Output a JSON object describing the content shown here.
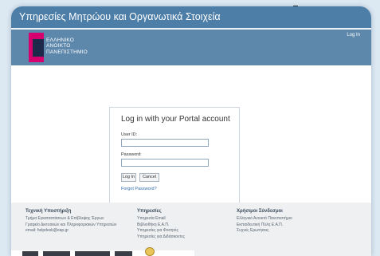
{
  "window": {
    "title": "Υπηρεσίες Μητρώου και Οργανωτικά Στοιχεία"
  },
  "header": {
    "logo_lines": [
      "ΕΛΛΗΝΙΚΟ",
      "ΑΝΟΙΚΤΟ",
      "ΠΑΝΕΠΙΣΤΗΜΙΟ"
    ],
    "login_link": "Log In",
    "colors": {
      "title_bar": "#4d7ea8",
      "banner": "#5e88ab",
      "logo_magenta": "#d6006e",
      "logo_navy": "#1e2a4a"
    }
  },
  "login": {
    "title": "Log in with your Portal account",
    "user_id_label": "User ID:",
    "user_id_value": "",
    "password_label": "Password:",
    "password_value": "",
    "login_button": "Log In",
    "cancel_button": "Cancel",
    "forgot_link": "Forgot Password?"
  },
  "footer": {
    "columns": [
      {
        "heading": "Τεχνική Υποστήριξη",
        "links": [
          "Τμήμα Εγκαταστάσεων & Επίβλεψης Έργων",
          "Γραφείο Δικτυακών και Πληροφοριακών Υπηρεσιών",
          "email: helpdesk@eap.gr"
        ]
      },
      {
        "heading": "Υπηρεσίες",
        "links": [
          "Υπηρεσία Email",
          "Βιβλιοθήκη Ε.Α.Π.",
          "Υπηρεσίες για Φοιτητές",
          "Υπηρεσίες για Διδάσκοντες"
        ]
      },
      {
        "heading": "Χρήσιμοι Σύνδεσμοι",
        "links": [
          "Ελληνικό Ανοικτό Πανεπιστήμιο",
          "Εκπαιδευτική Πύλη Ε.Α.Π.",
          "Συχνές Ερωτήσεις"
        ]
      }
    ]
  }
}
